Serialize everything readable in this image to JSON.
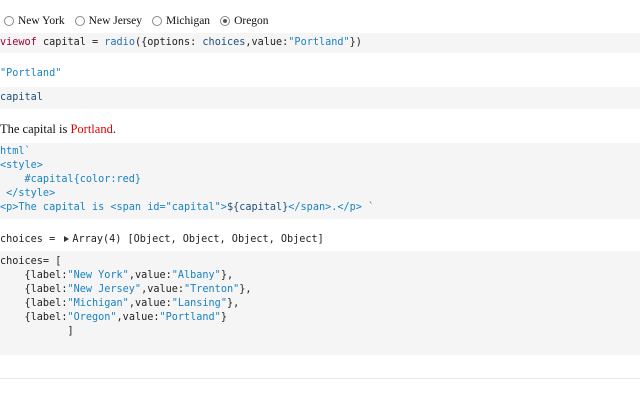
{
  "radio": {
    "options": [
      "New York",
      "New Jersey",
      "Michigan",
      "Oregon"
    ],
    "selected_index": 3
  },
  "cell1": {
    "t1": "viewof",
    "t2": " capital = ",
    "t3": "radio",
    "t4": "({options: ",
    "t5": "choices",
    "t6": ",value:",
    "t7": "\"Portland\"",
    "t8": "})"
  },
  "out1": {
    "value": "\"Portland\""
  },
  "cell2": {
    "code": "capital"
  },
  "prose": {
    "before": "The capital is ",
    "value": "Portland",
    "after": "."
  },
  "cell3": {
    "l1": "html`",
    "l2": "<style>",
    "l3": "    #capital{color:red}",
    "l4": " </style>",
    "l5a": "<p>The capital is <span id=\"capital\">",
    "l5b": "${capital}",
    "l5c": "</span>.</p> `"
  },
  "out2": {
    "prefix": "choices = ",
    "value": "Array(4) [Object, Object, Object, Object]"
  },
  "cell4": {
    "l1": "choices= [",
    "rows": [
      {
        "a": "    {label:",
        "b": "\"New York\"",
        "c": ",value:",
        "d": "\"Albany\"",
        "e": "},"
      },
      {
        "a": "    {label:",
        "b": "\"New Jersey\"",
        "c": ",value:",
        "d": "\"Trenton\"",
        "e": "},"
      },
      {
        "a": "    {label:",
        "b": "\"Michigan\"",
        "c": ",value:",
        "d": "\"Lansing\"",
        "e": "},"
      },
      {
        "a": "    {label:",
        "b": "\"Oregon\"",
        "c": ",value:",
        "d": "\"Portland\"",
        "e": "}"
      }
    ],
    "l6": "           ]"
  }
}
